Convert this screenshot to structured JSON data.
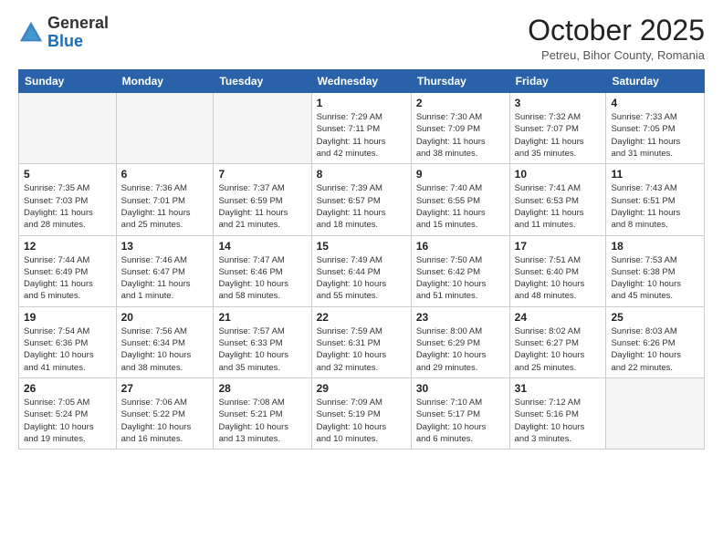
{
  "header": {
    "logo_general": "General",
    "logo_blue": "Blue",
    "month_title": "October 2025",
    "subtitle": "Petreu, Bihor County, Romania"
  },
  "days_of_week": [
    "Sunday",
    "Monday",
    "Tuesday",
    "Wednesday",
    "Thursday",
    "Friday",
    "Saturday"
  ],
  "weeks": [
    [
      {
        "day": "",
        "info": ""
      },
      {
        "day": "",
        "info": ""
      },
      {
        "day": "",
        "info": ""
      },
      {
        "day": "1",
        "info": "Sunrise: 7:29 AM\nSunset: 7:11 PM\nDaylight: 11 hours\nand 42 minutes."
      },
      {
        "day": "2",
        "info": "Sunrise: 7:30 AM\nSunset: 7:09 PM\nDaylight: 11 hours\nand 38 minutes."
      },
      {
        "day": "3",
        "info": "Sunrise: 7:32 AM\nSunset: 7:07 PM\nDaylight: 11 hours\nand 35 minutes."
      },
      {
        "day": "4",
        "info": "Sunrise: 7:33 AM\nSunset: 7:05 PM\nDaylight: 11 hours\nand 31 minutes."
      }
    ],
    [
      {
        "day": "5",
        "info": "Sunrise: 7:35 AM\nSunset: 7:03 PM\nDaylight: 11 hours\nand 28 minutes."
      },
      {
        "day": "6",
        "info": "Sunrise: 7:36 AM\nSunset: 7:01 PM\nDaylight: 11 hours\nand 25 minutes."
      },
      {
        "day": "7",
        "info": "Sunrise: 7:37 AM\nSunset: 6:59 PM\nDaylight: 11 hours\nand 21 minutes."
      },
      {
        "day": "8",
        "info": "Sunrise: 7:39 AM\nSunset: 6:57 PM\nDaylight: 11 hours\nand 18 minutes."
      },
      {
        "day": "9",
        "info": "Sunrise: 7:40 AM\nSunset: 6:55 PM\nDaylight: 11 hours\nand 15 minutes."
      },
      {
        "day": "10",
        "info": "Sunrise: 7:41 AM\nSunset: 6:53 PM\nDaylight: 11 hours\nand 11 minutes."
      },
      {
        "day": "11",
        "info": "Sunrise: 7:43 AM\nSunset: 6:51 PM\nDaylight: 11 hours\nand 8 minutes."
      }
    ],
    [
      {
        "day": "12",
        "info": "Sunrise: 7:44 AM\nSunset: 6:49 PM\nDaylight: 11 hours\nand 5 minutes."
      },
      {
        "day": "13",
        "info": "Sunrise: 7:46 AM\nSunset: 6:47 PM\nDaylight: 11 hours\nand 1 minute."
      },
      {
        "day": "14",
        "info": "Sunrise: 7:47 AM\nSunset: 6:46 PM\nDaylight: 10 hours\nand 58 minutes."
      },
      {
        "day": "15",
        "info": "Sunrise: 7:49 AM\nSunset: 6:44 PM\nDaylight: 10 hours\nand 55 minutes."
      },
      {
        "day": "16",
        "info": "Sunrise: 7:50 AM\nSunset: 6:42 PM\nDaylight: 10 hours\nand 51 minutes."
      },
      {
        "day": "17",
        "info": "Sunrise: 7:51 AM\nSunset: 6:40 PM\nDaylight: 10 hours\nand 48 minutes."
      },
      {
        "day": "18",
        "info": "Sunrise: 7:53 AM\nSunset: 6:38 PM\nDaylight: 10 hours\nand 45 minutes."
      }
    ],
    [
      {
        "day": "19",
        "info": "Sunrise: 7:54 AM\nSunset: 6:36 PM\nDaylight: 10 hours\nand 41 minutes."
      },
      {
        "day": "20",
        "info": "Sunrise: 7:56 AM\nSunset: 6:34 PM\nDaylight: 10 hours\nand 38 minutes."
      },
      {
        "day": "21",
        "info": "Sunrise: 7:57 AM\nSunset: 6:33 PM\nDaylight: 10 hours\nand 35 minutes."
      },
      {
        "day": "22",
        "info": "Sunrise: 7:59 AM\nSunset: 6:31 PM\nDaylight: 10 hours\nand 32 minutes."
      },
      {
        "day": "23",
        "info": "Sunrise: 8:00 AM\nSunset: 6:29 PM\nDaylight: 10 hours\nand 29 minutes."
      },
      {
        "day": "24",
        "info": "Sunrise: 8:02 AM\nSunset: 6:27 PM\nDaylight: 10 hours\nand 25 minutes."
      },
      {
        "day": "25",
        "info": "Sunrise: 8:03 AM\nSunset: 6:26 PM\nDaylight: 10 hours\nand 22 minutes."
      }
    ],
    [
      {
        "day": "26",
        "info": "Sunrise: 7:05 AM\nSunset: 5:24 PM\nDaylight: 10 hours\nand 19 minutes."
      },
      {
        "day": "27",
        "info": "Sunrise: 7:06 AM\nSunset: 5:22 PM\nDaylight: 10 hours\nand 16 minutes."
      },
      {
        "day": "28",
        "info": "Sunrise: 7:08 AM\nSunset: 5:21 PM\nDaylight: 10 hours\nand 13 minutes."
      },
      {
        "day": "29",
        "info": "Sunrise: 7:09 AM\nSunset: 5:19 PM\nDaylight: 10 hours\nand 10 minutes."
      },
      {
        "day": "30",
        "info": "Sunrise: 7:10 AM\nSunset: 5:17 PM\nDaylight: 10 hours\nand 6 minutes."
      },
      {
        "day": "31",
        "info": "Sunrise: 7:12 AM\nSunset: 5:16 PM\nDaylight: 10 hours\nand 3 minutes."
      },
      {
        "day": "",
        "info": ""
      }
    ]
  ]
}
